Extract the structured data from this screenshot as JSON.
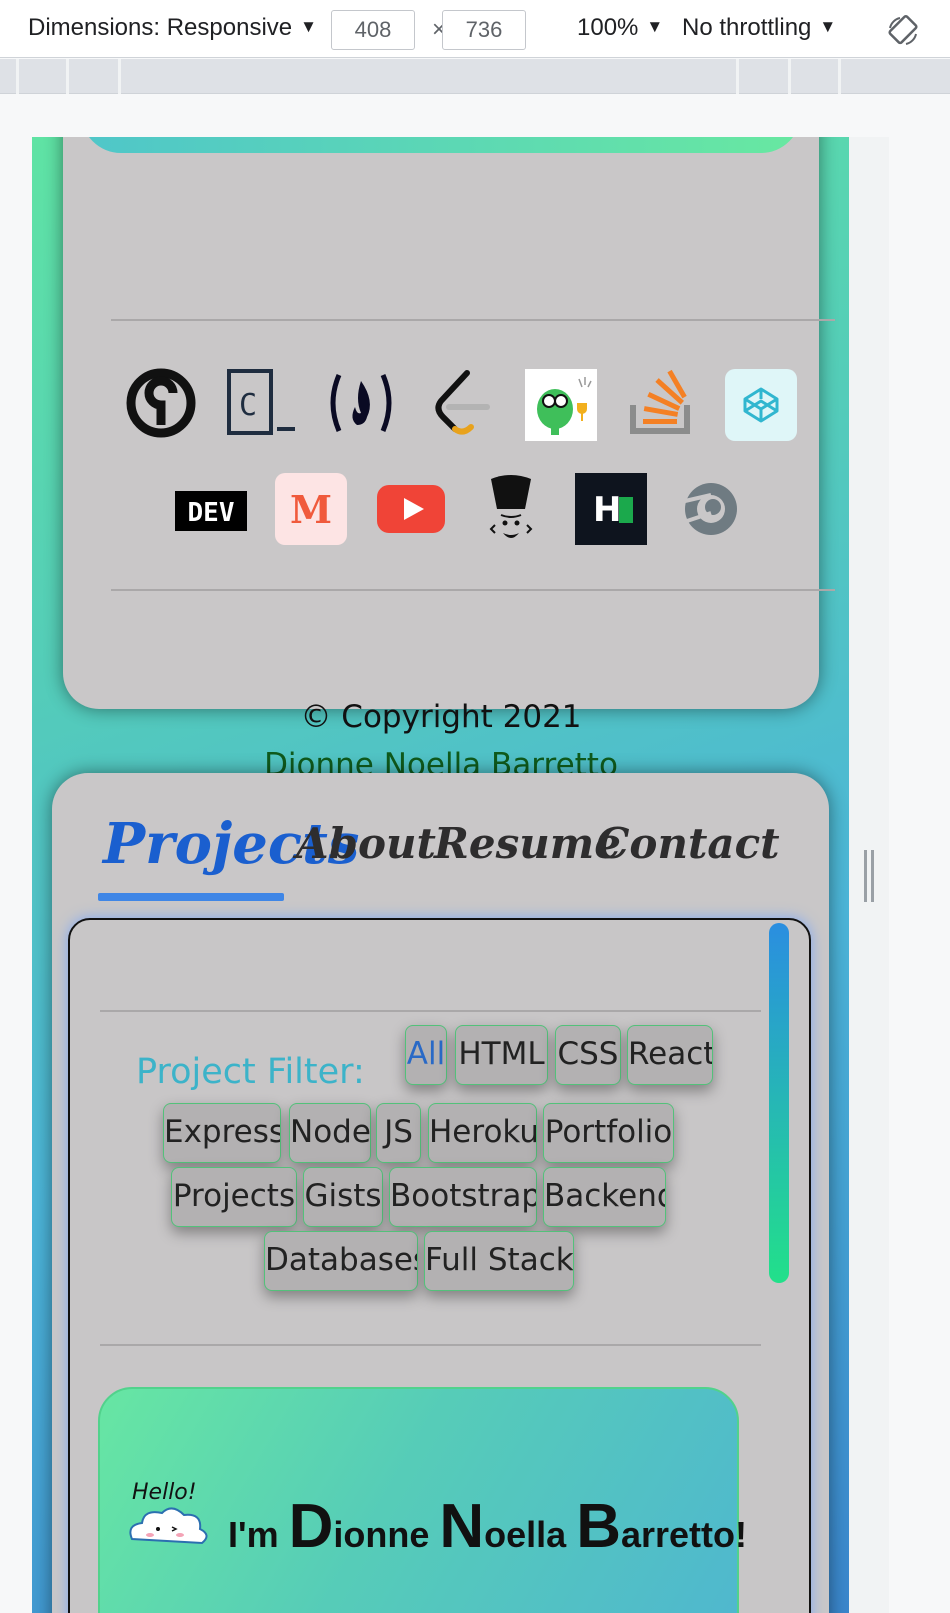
{
  "devtools": {
    "dimensions_label": "Dimensions: Responsive",
    "width_value": "408",
    "times": "×",
    "height_value": "736",
    "zoom": "100%",
    "throttling": "No throttling",
    "dropdown_arrow": "▼"
  },
  "footer": {
    "social_icons": [
      "open-collective-icon",
      "codecademy-icon",
      "freecodecamp-icon",
      "leetcode-icon",
      "kaggle-mascot-icon",
      "stack-overflow-icon",
      "codepen-icon",
      "dev-icon",
      "medium-icon",
      "youtube-icon",
      "chef-icon",
      "hackerrank-icon",
      "blender-icon"
    ],
    "dev_text": "DEV",
    "medium_text": "M",
    "hackerrank_text": "H",
    "codecademy_text": "C",
    "copyright": "© Copyright 2021",
    "author": "Dionne Noella Barretto"
  },
  "nav": {
    "tabs": [
      {
        "label": "Projects",
        "active": true
      },
      {
        "label": "About"
      },
      {
        "label": "Resume"
      },
      {
        "label": "Contact"
      }
    ]
  },
  "projects": {
    "filter_label": "Project Filter:",
    "filters": [
      "All",
      "HTML",
      "CSS",
      "React",
      "Express",
      "Node",
      "JS",
      "Heroku",
      "Portfolio",
      "Projects",
      "Gists",
      "Bootstrap",
      "Backend",
      "Databases",
      "Full Stack"
    ],
    "active_filter": "All"
  },
  "hero": {
    "hello": "Hello!",
    "title_prefix": "I'm ",
    "name_parts": [
      {
        "cap": "D",
        "rest": "ionne "
      },
      {
        "cap": "N",
        "rest": "oella "
      },
      {
        "cap": "B",
        "rest": "arretto!"
      }
    ]
  },
  "colors": {
    "accent_blue": "#1a5fcf",
    "filter_teal": "#3cb3c9",
    "author_green": "#0f5a1c",
    "card_gray": "#c9c7c8"
  }
}
